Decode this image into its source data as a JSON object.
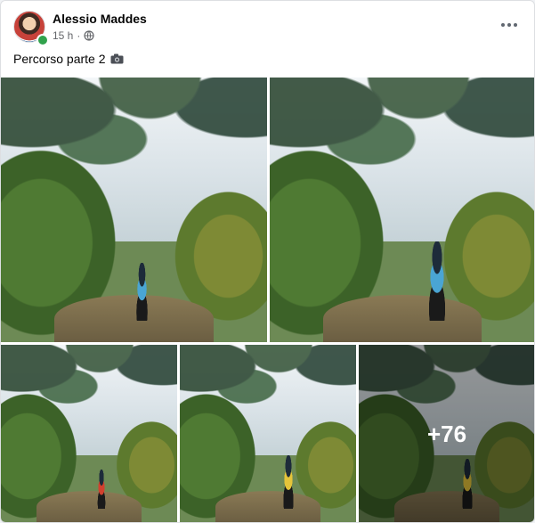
{
  "post": {
    "author": "Alessio Maddes",
    "time": "15 h",
    "separator": "·",
    "audience_icon": "globe-icon",
    "caption": "Percorso parte 2",
    "caption_icon": "camera-icon",
    "more_icon": "more-horizontal-icon"
  },
  "photos": {
    "large": [
      {
        "alt": "photo-1",
        "rider_color": "blue"
      },
      {
        "alt": "photo-2",
        "rider_color": "blue"
      }
    ],
    "small": [
      {
        "alt": "photo-3",
        "rider_color": "red"
      },
      {
        "alt": "photo-4",
        "rider_color": "yellow"
      },
      {
        "alt": "photo-5",
        "rider_color": "yellow"
      }
    ],
    "more_count": "+76"
  },
  "colors": {
    "online": "#31a24c",
    "secondary_text": "#65676b",
    "primary_text": "#050505"
  }
}
